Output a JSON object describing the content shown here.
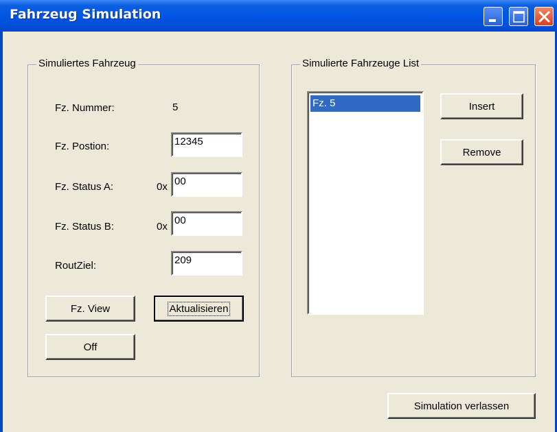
{
  "window": {
    "title": "Fahrzeug Simulation",
    "controls": {
      "minimize": "minimize-icon",
      "maximize": "maximize-icon",
      "close": "close-icon"
    }
  },
  "vehicle_group": {
    "label": "Simuliertes Fahrzeug",
    "nummer_label": "Fz. Nummer:",
    "nummer_value": "5",
    "position_label": "Fz. Postion:",
    "position_value": "12345",
    "status_a_label": "Fz. Status A:",
    "status_a_prefix": "0x",
    "status_a_value": "00",
    "status_b_label": "Fz. Status B:",
    "status_b_prefix": "0x",
    "status_b_value": "00",
    "routziel_label": "RoutZiel:",
    "routziel_value": "209",
    "fz_view_button": "Fz. View",
    "aktualisieren_button": "Aktualisieren",
    "off_button": "Off"
  },
  "list_group": {
    "label": "Simulierte Fahrzeuge List",
    "items": [
      "Fz. 5"
    ],
    "selected_index": 0,
    "insert_button": "Insert",
    "remove_button": "Remove"
  },
  "footer": {
    "exit_button": "Simulation verlassen"
  },
  "colors": {
    "titlebar": "#0054e3",
    "dialog_bg": "#ece9d8",
    "selection": "#316ac5",
    "close_button": "#d8401c"
  }
}
